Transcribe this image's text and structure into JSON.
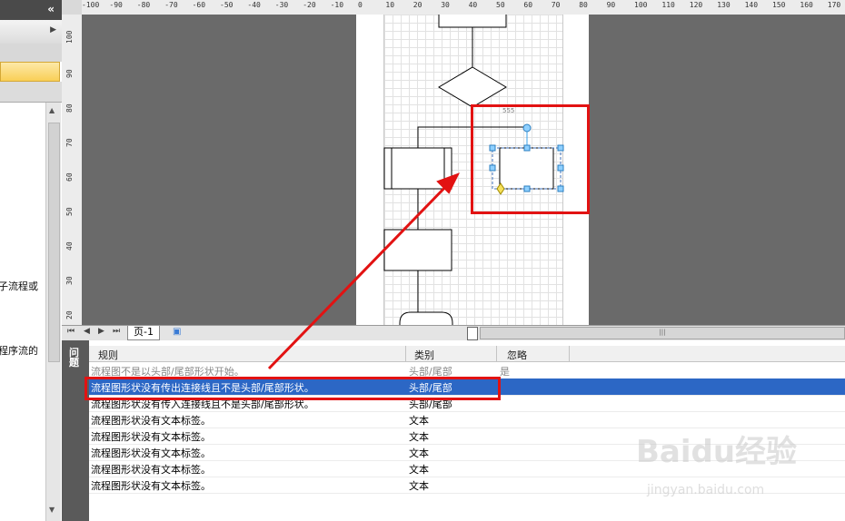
{
  "left_panel": {
    "header_arrows": "«",
    "menu_arrow": "▶",
    "text_lines": [
      "子流程或",
      "程序流的"
    ]
  },
  "ruler": {
    "top_ticks": [
      "-100",
      "-90",
      "-80",
      "-70",
      "-60",
      "-50",
      "-40",
      "-30",
      "-20",
      "-10",
      "0",
      "10",
      "20",
      "30",
      "40",
      "50",
      "60",
      "70",
      "80",
      "90",
      "100",
      "110",
      "120",
      "130",
      "140",
      "150",
      "160",
      "170"
    ],
    "left_ticks": [
      "100",
      "90",
      "80",
      "70",
      "60",
      "50",
      "40",
      "30",
      "20"
    ]
  },
  "canvas": {
    "shape_label": "555"
  },
  "page_tabs": {
    "active_tab": "页-1"
  },
  "issues_window": {
    "side_label": "问题",
    "columns": [
      "规则",
      "类别",
      "忽略"
    ],
    "rows": [
      {
        "rule": "流程图不是以头部/尾部形状开始。",
        "category": "头部/尾部",
        "ignore": "是",
        "state": "dim"
      },
      {
        "rule": "流程图形状没有传出连接线且不是头部/尾部形状。",
        "category": "头部/尾部",
        "ignore": "",
        "state": "selected"
      },
      {
        "rule": "流程图形状没有传入连接线且不是头部/尾部形状。",
        "category": "头部/尾部",
        "ignore": "",
        "state": "normal"
      },
      {
        "rule": "流程图形状没有文本标签。",
        "category": "文本",
        "ignore": "",
        "state": "normal"
      },
      {
        "rule": "流程图形状没有文本标签。",
        "category": "文本",
        "ignore": "",
        "state": "normal"
      },
      {
        "rule": "流程图形状没有文本标签。",
        "category": "文本",
        "ignore": "",
        "state": "normal"
      },
      {
        "rule": "流程图形状没有文本标签。",
        "category": "文本",
        "ignore": "",
        "state": "normal"
      },
      {
        "rule": "流程图形状没有文本标签。",
        "category": "文本",
        "ignore": "",
        "state": "normal"
      }
    ]
  },
  "watermark": {
    "brand": "Baidu经验",
    "url": "jingyan.baidu.com"
  },
  "colors": {
    "selection": "#2c67c5",
    "annotation_red": "#e21212",
    "handle_blue": "#3aa0e8"
  }
}
